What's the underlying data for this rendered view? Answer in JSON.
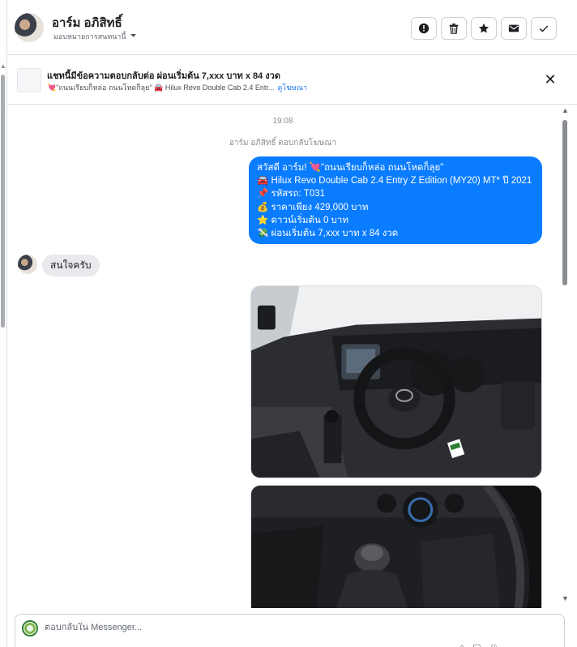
{
  "header": {
    "contact_name": "อาร์ม อภิสิทธิ์",
    "assign_label": "มอบหมายการสนทนานี้",
    "actions": [
      {
        "name": "mark-spam-button",
        "icon": "alert-circle-icon"
      },
      {
        "name": "delete-button",
        "icon": "trash-icon"
      },
      {
        "name": "star-button",
        "icon": "star-icon"
      },
      {
        "name": "mark-unread-button",
        "icon": "envelope-icon"
      },
      {
        "name": "mark-done-button",
        "icon": "check-icon"
      }
    ]
  },
  "ad_banner": {
    "title": "แชทนี้มีข้อความตอบกลับต่อ ผ่อนเริ่มต้น 7,xxx บาท x 84 งวด",
    "subtitle": "💘\"ถนนเรียบก็หล่อ ถนนโหดก็ลุย\" 🚘 Hilux Revo Double Cab 2.4 Entr...",
    "link_label": "ดูโฆษณา"
  },
  "chat": {
    "timestamp": "19:08",
    "reply_note": "อาร์ม อภิสิทธิ์ ตอบกลับโฆษณา",
    "outgoing_lines": [
      "สวัสดี อาร์ม! 💘\"ถนนเรียบก็หล่อ ถนนโหดก็ลุย\"",
      "🚘 Hilux Revo Double Cab 2.4 Entry Z Edition (MY20) MT* ปี 2021",
      "📌 รหัสรถ: T031",
      "💰 ราคาเพียง 429,000 บาท",
      "⭐ ดาวน์เริ่มต้น 0 บาท",
      "💸 ผ่อนเริ่มต้น 7,xxx บาท x 84 งวด"
    ],
    "incoming_text": "สนใจครับ"
  },
  "composer": {
    "placeholder": "ตอบกลับใน Messenger..."
  },
  "colors": {
    "accent": "#0a7cff",
    "incoming_bubble": "#e9eaed",
    "link": "#1877f2"
  }
}
